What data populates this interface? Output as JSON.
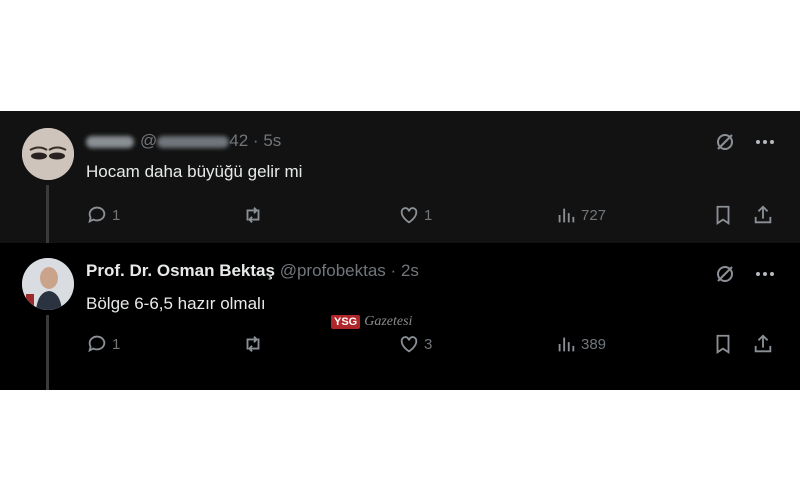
{
  "tweets": [
    {
      "handle_suffix": "42",
      "time": "5s",
      "text": "Hocam daha büyüğü gelir mi",
      "actions": {
        "replies": "1",
        "likes": "1",
        "views": "727"
      }
    },
    {
      "name": "Prof. Dr. Osman Bektaş",
      "handle": "@profobektas",
      "time": "2s",
      "text": "Bölge 6-6,5  hazır olmalı",
      "actions": {
        "replies": "1",
        "likes": "3",
        "views": "389"
      }
    }
  ],
  "watermark": {
    "badge": "YSG",
    "text": "Gazetesi"
  },
  "colors": {
    "text": "#e7e9ea",
    "muted": "#71767b",
    "background": "#000000"
  },
  "icons": [
    "grok-icon",
    "more-icon",
    "reply-icon",
    "retweet-icon",
    "like-icon",
    "views-icon",
    "bookmark-icon",
    "share-icon"
  ]
}
